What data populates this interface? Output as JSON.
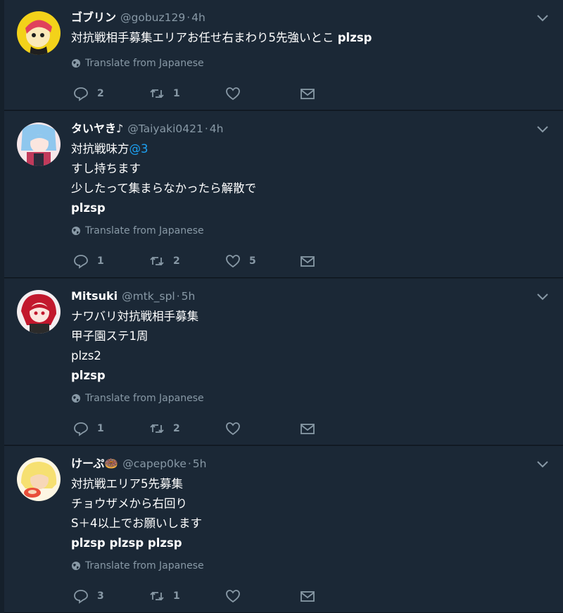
{
  "tweets": [
    {
      "name": "ゴブリン",
      "handle": "@gobuz129",
      "dot": "·",
      "time": "4h",
      "lines": [
        {
          "text": "対抗戦相手募集エリアお任せ右まわり5先強いとこ ",
          "tag": "plzsp"
        }
      ],
      "translate": "Translate from Japanese",
      "replies": "2",
      "retweets": "1",
      "likes": "",
      "avatar_colors": [
        "#f3d21a",
        "#e0415c",
        "#1f1f1f"
      ]
    },
    {
      "name": "タいヤき♪",
      "handle": "@Taiyaki0421",
      "dot": "·",
      "time": "4h",
      "lines": [
        {
          "text": "対抗戦味方",
          "mention": "@3"
        },
        {
          "text": "すし持ちます"
        },
        {
          "text": "少したって集まらなかったら解散で"
        },
        {
          "tag": "plzsp"
        }
      ],
      "translate": "Translate from Japanese",
      "replies": "1",
      "retweets": "2",
      "likes": "5",
      "avatar_colors": [
        "#8fc7ee",
        "#c23a5b",
        "#f6e7ea"
      ]
    },
    {
      "name": "Mitsuki",
      "handle": "@mtk_spl",
      "dot": "·",
      "time": "5h",
      "lines": [
        {
          "text": "ナワバリ対抗戦相手募集"
        },
        {
          "text": "甲子園ステ1周"
        },
        {
          "text": "plzs2"
        },
        {
          "tag": "plzsp"
        }
      ],
      "translate": "Translate from Japanese",
      "replies": "1",
      "retweets": "2",
      "likes": "",
      "avatar_colors": [
        "#f4eef0",
        "#c2182d",
        "#2b2b2b"
      ]
    },
    {
      "name": "けーぷ🍩",
      "handle": "@capep0ke",
      "dot": "·",
      "time": "5h",
      "lines": [
        {
          "text": "対抗戦エリア5先募集"
        },
        {
          "text": "チョウザメから右回り"
        },
        {
          "text": "S＋4以上でお願いします"
        },
        {
          "tag": "plzsp plzsp plzsp"
        }
      ],
      "translate": "Translate from Japanese",
      "replies": "3",
      "retweets": "1",
      "likes": "",
      "avatar_colors": [
        "#f6e071",
        "#e94f3a",
        "#f7d7b8"
      ]
    }
  ]
}
